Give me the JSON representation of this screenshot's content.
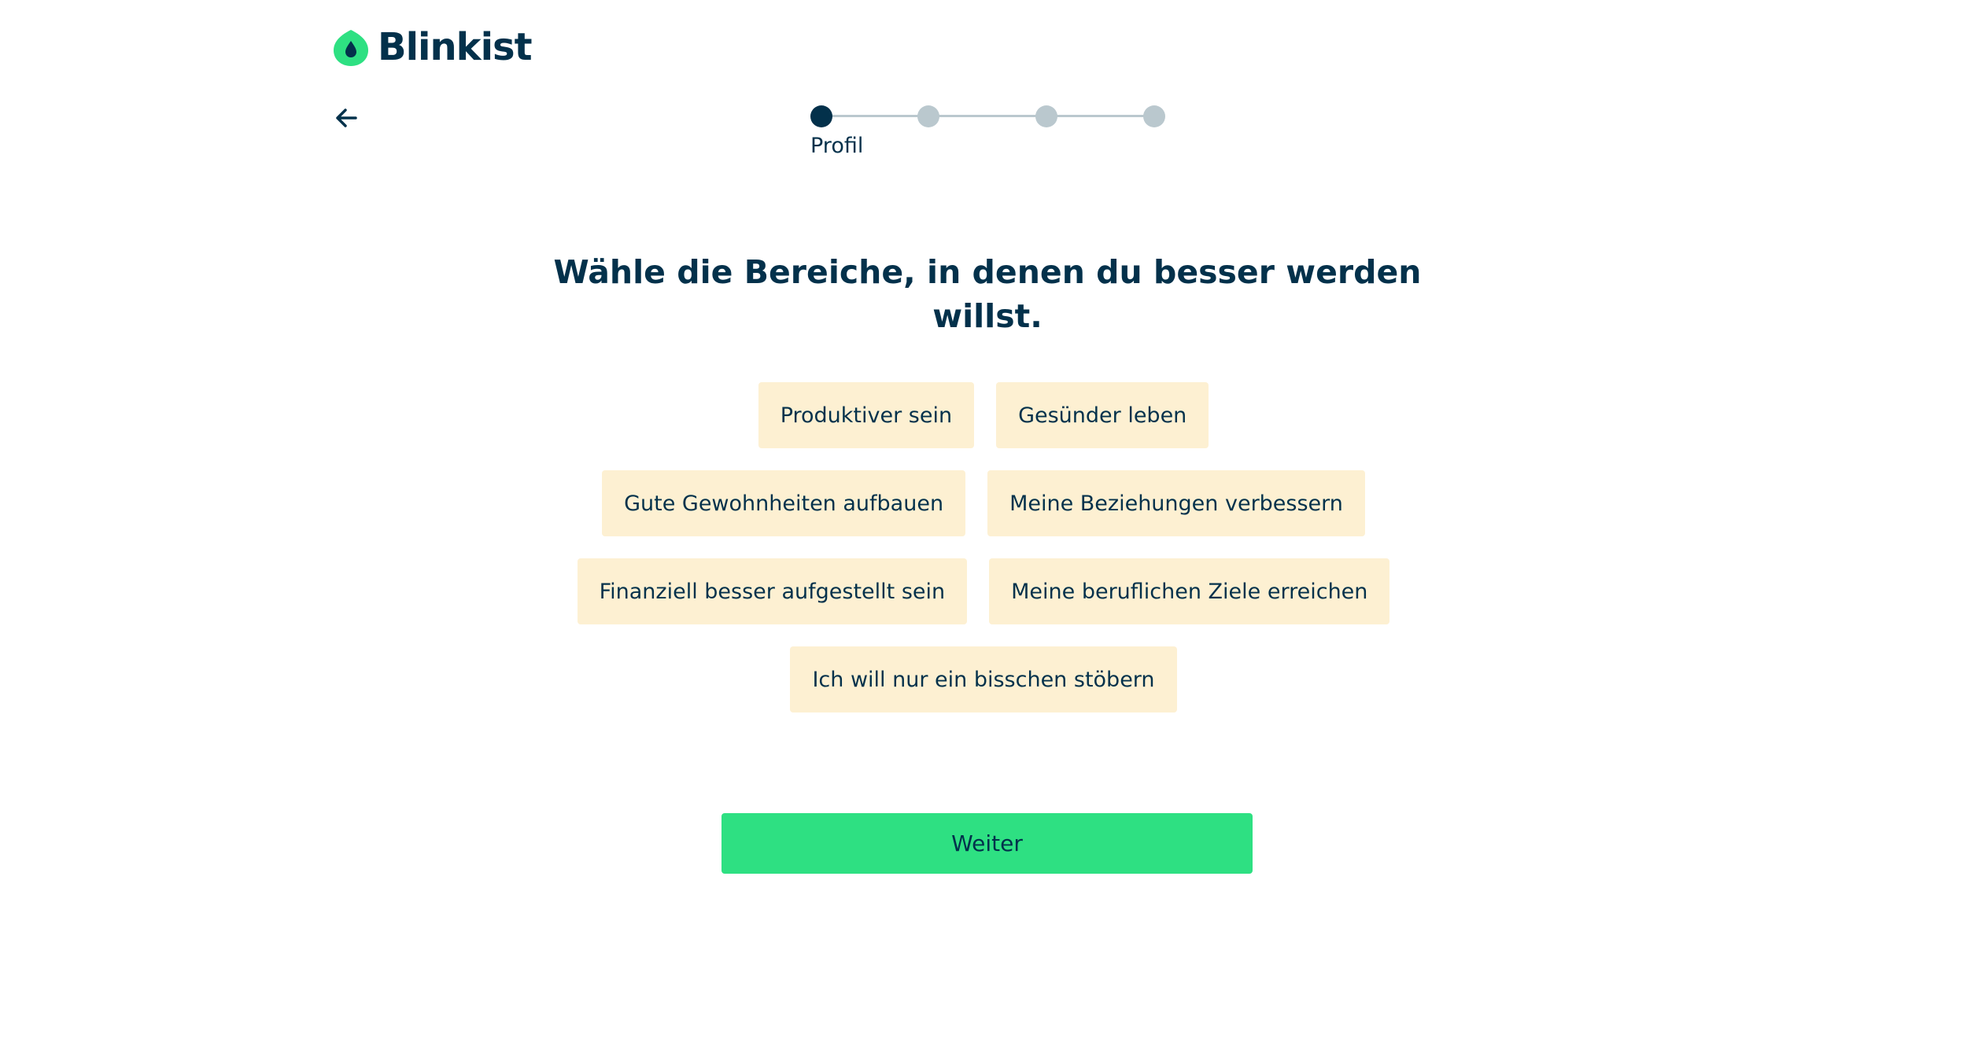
{
  "brand": {
    "name": "Blinkist",
    "logo_icon": "blinkist-leaf-icon",
    "accent_color": "#2ee082",
    "text_color": "#03314b"
  },
  "nav": {
    "back_icon": "arrow-left-icon"
  },
  "stepper": {
    "total_steps": 4,
    "current_step": 1,
    "current_label": "Profil"
  },
  "main": {
    "heading": "Wähle die Bereiche, in denen du besser werden willst.",
    "options": [
      [
        "Produktiver sein",
        "Gesünder leben"
      ],
      [
        "Gute Gewohnheiten aufbauen",
        "Meine Beziehungen verbessern"
      ],
      [
        "Finanziell besser aufgestellt sein",
        "Meine beruflichen Ziele erreichen"
      ],
      [
        "Ich will nur ein bisschen stöbern"
      ]
    ],
    "continue_label": "Weiter"
  }
}
